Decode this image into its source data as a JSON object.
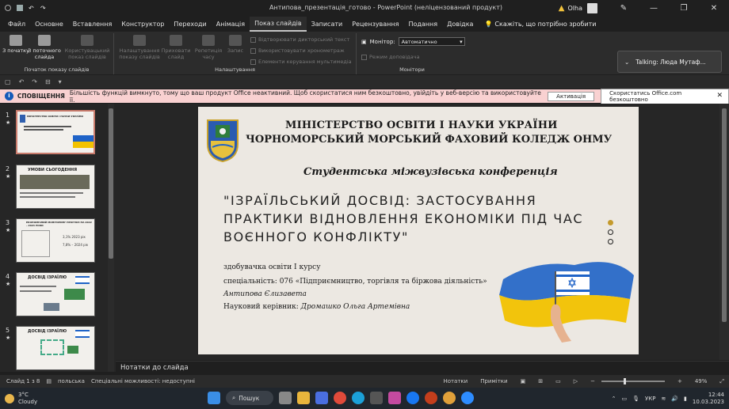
{
  "window": {
    "title": "Антипова_презентація_готово  -  PowerPoint (неліцензований продукт)",
    "user": "Olha"
  },
  "tabs": [
    "Файл",
    "Основне",
    "Вставлення",
    "Конструктор",
    "Переходи",
    "Анімація",
    "Показ слайдів",
    "Записати",
    "Рецензування",
    "Подання",
    "Довідка"
  ],
  "active_tab": "Показ слайдів",
  "tell_me": "Скажіть, що потрібно зробити",
  "ribbon": {
    "group1": {
      "label": "Початок показу слайдів",
      "btn1": "З початку",
      "btn2": "З поточного слайда",
      "btn3": "Користувацький показ слайдів"
    },
    "group2": {
      "label": "Налаштування",
      "btn1": "Налаштування показу слайдів",
      "btn2": "Приховати слайд",
      "btn3": "Репетиція часу",
      "btn4": "Запис",
      "chk1": "Відтворювати дикторський текст",
      "chk2": "Використовувати хронометраж",
      "chk3": "Елементи керування мультимедіа"
    },
    "group3": {
      "label": "Монітори",
      "monitor_label": "Монітор:",
      "monitor_value": "Автоматично",
      "presenter_view": "Режим доповідача"
    }
  },
  "toast": {
    "text": "Talking: Люда Мутаф..."
  },
  "infobar": {
    "title": "СПОВІЩЕННЯ",
    "message": "Більшість функцій вимкнуто, тому що ваш продукт Office неактивний. Щоб скористатися ним безкоштовно, увійдіть у веб-версію та використовуйте її.",
    "btn_activate": "Активація",
    "btn_web": "Скористатись Office.com безкоштовно"
  },
  "thumbnails": [
    {
      "num": "1",
      "title": "МІНІСТЕРСТВО ОСВІТИ І НАУКИ УКРАЇНИ"
    },
    {
      "num": "2",
      "title": "УМОВИ СЬОГОДЕННЯ"
    },
    {
      "num": "3",
      "title": "ЕКОНОМІЧНИЙ МОНІТОРИНГ ПРОГНОЗ НА 2022 – 2024 РОКИ",
      "v1": "3,1% 2023 рік",
      "v2": "7,8% – 2024 рік"
    },
    {
      "num": "4",
      "title": "ДОСВІД ІЗРАЇЛЮ"
    },
    {
      "num": "5",
      "title": "ДОСВІД ІЗРАЇЛЮ"
    }
  ],
  "slide": {
    "line1": "МІНІСТЕРСТВО ОСВІТИ І НАУКИ УКРАЇНИ",
    "line2": "ЧОРНОМОРСЬКИЙ МОРСЬКИЙ ФАХОВИЙ КОЛЕДЖ ОНМУ",
    "conference": "Студентська міжвузівська конференція",
    "topic": "\"ІЗРАЇЛЬСЬКИЙ ДОСВІД: ЗАСТОСУВАННЯ ПРАКТИКИ ВІДНОВЛЕННЯ ЕКОНОМІКИ ПІД ЧАС ВОЄННОГО КОНФЛІКТУ\"",
    "student_level": "здобувачка освіти І курсу",
    "specialty": "спеціальність: 076 «Підприємництво, торгівля та біржова діяльність»",
    "student_name": "Антипова Єлизавета",
    "supervisor_label": "Науковий керівник:",
    "supervisor_name": "Дромашко Ольга Артемівна"
  },
  "notes_placeholder": "Нотатки до слайда",
  "status": {
    "slide_info": "Слайд 1 з 8",
    "language": "польська",
    "accessibility": "Спеціальні можливості: недоступні",
    "notes": "Нотатки",
    "comments": "Примітки",
    "zoom": "49%"
  },
  "taskbar": {
    "temp": "3°C",
    "weather": "Cloudy",
    "search": "Пошук",
    "lang": "УКР",
    "time": "12:44",
    "date": "10.03.2023"
  },
  "colors": {
    "accent": "#c43e1c",
    "infobar": "#f9d1d1",
    "ukraine_blue": "#1f63c7",
    "ukraine_yellow": "#f2c200"
  }
}
